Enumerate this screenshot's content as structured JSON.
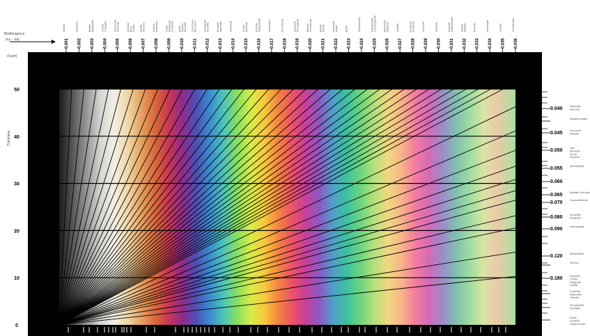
{
  "chart_data": {
    "type": "line",
    "title": "",
    "birefringence_label": "Birefringence",
    "birefringence_formula": "(nγ − nα)",
    "thickness_label": "Thickness",
    "thickness_unit": "d (µm)",
    "ylim": [
      0,
      50
    ],
    "y_ticks": [
      0,
      10,
      20,
      30,
      40,
      50
    ],
    "top_axis": [
      {
        "value": "0.001",
        "minerals": [
          "Nitrate"
        ]
      },
      {
        "value": "0.002",
        "minerals": [
          "Nepheline"
        ]
      },
      {
        "value": "0.003",
        "minerals": [
          "Melilite",
          "Apophyllite"
        ]
      },
      {
        "value": "0.004",
        "minerals": [
          "Leucite",
          "Chabazite"
        ]
      },
      {
        "value": "0.005",
        "minerals": [
          "Clinozoisite",
          "Penninite"
        ]
      },
      {
        "value": "0.006",
        "minerals": [
          "Idocrase",
          "Beryl",
          "Zoisite"
        ]
      },
      {
        "value": "0.007",
        "minerals": [
          "Apatite",
          "Sanidine"
        ]
      },
      {
        "value": "0.008",
        "minerals": [
          "Chlorite",
          "Nepheline"
        ]
      },
      {
        "value": "0.009",
        "minerals": [
          "Topaz",
          "Andalusite",
          "Cordierite"
        ]
      },
      {
        "value": "0.010",
        "minerals": [
          "Albite",
          "Gypsum",
          "Anorthite"
        ]
      },
      {
        "value": "0.011",
        "minerals": [
          "Clinochlore",
          "Microcline"
        ]
      },
      {
        "value": "0.012",
        "minerals": [
          "Labradorite",
          "Anorthite"
        ]
      },
      {
        "value": "0.013",
        "minerals": [
          "Enstatite",
          "Staurolite"
        ]
      },
      {
        "value": "0.014",
        "minerals": [
          "Sillimanite"
        ]
      },
      {
        "value": "0.015",
        "minerals": [
          "Zoisite",
          "Actinolite"
        ]
      },
      {
        "value": "0.016",
        "minerals": [
          "Prehnite",
          "Wollastonite"
        ]
      },
      {
        "value": "0.017",
        "minerals": [
          "Serpentine"
        ]
      },
      {
        "value": "0.018",
        "minerals": [
          "Hornblende"
        ]
      },
      {
        "value": "0.019",
        "minerals": [
          "Lawsonite",
          "Pumpellyite"
        ]
      },
      {
        "value": "0.020",
        "minerals": [
          "Kyanite",
          "Hornblende"
        ]
      },
      {
        "value": "0.021",
        "minerals": [
          "Bastite",
          "Axinite"
        ]
      },
      {
        "value": "0.022",
        "minerals": [
          "Cancrinite",
          "Augite"
        ]
      },
      {
        "value": "0.023",
        "minerals": [
          "Barite"
        ]
      },
      {
        "value": "0.024",
        "minerals": [
          "Glaucophane"
        ]
      },
      {
        "value": "0.025",
        "minerals": [
          "Anthophyllite",
          "Cummingtonite"
        ]
      },
      {
        "value": "0.026",
        "minerals": [
          "Riebeckite",
          "Pigeonite"
        ]
      },
      {
        "value": "0.027",
        "minerals": [
          "Lazulite"
        ]
      },
      {
        "value": "0.028",
        "minerals": [
          "Cordierite",
          "Forsterite"
        ]
      },
      {
        "value": "0.029",
        "minerals": [
          "Tremolite"
        ]
      },
      {
        "value": "0.030",
        "minerals": [
          "Diopside"
        ]
      },
      {
        "value": "0.031",
        "minerals": [
          "Diopside",
          "Hedenbergite"
        ]
      },
      {
        "value": "0.032",
        "minerals": [
          "Jadeite",
          "Fayalite"
        ]
      },
      {
        "value": "0.033",
        "minerals": [
          "Prehnite"
        ]
      },
      {
        "value": "0.034",
        "minerals": [
          "Norbergite"
        ]
      },
      {
        "value": "0.035",
        "minerals": [
          "Lazulite"
        ]
      },
      {
        "value": "0.036",
        "minerals": [
          "Chondrodite"
        ]
      }
    ],
    "right_axis": [
      {
        "value": "0.040",
        "minerals": [
          "Tephroite",
          "Idocrase"
        ]
      },
      {
        "value": "",
        "minerals": [
          "Aegirine-augite"
        ]
      },
      {
        "value": "0.045",
        "minerals": [
          "Grunerite",
          "Datolite"
        ]
      },
      {
        "value": "0.050",
        "minerals": [
          "Talc",
          "Monazite",
          "Zircon",
          "Aegirine"
        ]
      },
      {
        "value": "0.055",
        "minerals": [
          "Astrophyllite"
        ]
      },
      {
        "value": "0.060",
        "minerals": []
      },
      {
        "value": "0.065",
        "minerals": [
          "Basaltic Hornblende"
        ]
      },
      {
        "value": "0.070",
        "minerals": [
          "Oxyhornblende"
        ]
      },
      {
        "value": "0.080",
        "minerals": [
          "Anhydrite",
          "Aragonite"
        ]
      },
      {
        "value": "0.090",
        "minerals": [
          "Sideropyllite"
        ]
      },
      {
        "value": "0.120",
        "minerals": [
          "Baddeleyite"
        ]
      },
      {
        "value": "",
        "minerals": [
          "Sphene"
        ]
      },
      {
        "value": "0.180",
        "minerals": [
          "Dolomite",
          "Calcite",
          "Aragonite",
          "Calcite"
        ]
      },
      {
        "value": "",
        "minerals": [
          "Dolomite",
          "Magnesite",
          "Siderite"
        ]
      },
      {
        "value": "",
        "minerals": [
          "Pyrophanite",
          "Hematite"
        ]
      },
      {
        "value": "",
        "minerals": [
          "Rutile",
          "Goethite",
          "Lepidocrocite"
        ]
      }
    ],
    "birefringence_lines": [
      0.001,
      0.002,
      0.003,
      0.004,
      0.005,
      0.006,
      0.007,
      0.008,
      0.009,
      0.01,
      0.011,
      0.012,
      0.013,
      0.014,
      0.015,
      0.016,
      0.017,
      0.018,
      0.019,
      0.02,
      0.021,
      0.022,
      0.023,
      0.024,
      0.025,
      0.026,
      0.027,
      0.028,
      0.029,
      0.03,
      0.031,
      0.032,
      0.033,
      0.034,
      0.035,
      0.036,
      0.04,
      0.045,
      0.05,
      0.055,
      0.06,
      0.065,
      0.07,
      0.08,
      0.09,
      0.12,
      0.18
    ],
    "retardation_max_nm": 1850,
    "grid": true
  }
}
